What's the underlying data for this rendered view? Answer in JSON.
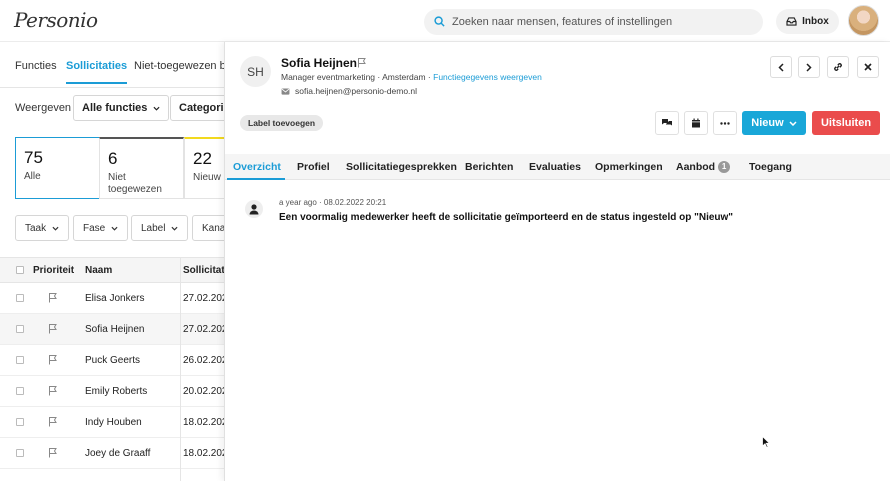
{
  "app": {
    "logo": "Personio"
  },
  "search": {
    "placeholder": "Zoeken naar mensen, features of instellingen"
  },
  "inbox": {
    "label": "Inbox"
  },
  "left": {
    "tabs": [
      "Functies",
      "Sollicitaties",
      "Niet-toegewezen ber"
    ],
    "filter_label": "Weergeven",
    "dropdowns": [
      "Alle functies",
      "Categorie"
    ],
    "stats": [
      {
        "num": "75",
        "label": "Alle"
      },
      {
        "num": "6",
        "label": "Niet toegewezen"
      },
      {
        "num": "22",
        "label": "Nieuw"
      }
    ],
    "filters": [
      "Taak",
      "Fase",
      "Label",
      "Kana"
    ],
    "columns": [
      "Prioriteit",
      "Naam",
      "Sollicitati"
    ],
    "rows": [
      {
        "name": "Elisa Jonkers",
        "date": "27.02.202"
      },
      {
        "name": "Sofia Heijnen",
        "date": "27.02.202"
      },
      {
        "name": "Puck Geerts",
        "date": "26.02.202"
      },
      {
        "name": "Emily Roberts",
        "date": "20.02.202"
      },
      {
        "name": "Indy Houben",
        "date": "18.02.202"
      },
      {
        "name": "Joey de Graaff",
        "date": "18.02.202"
      }
    ]
  },
  "panel": {
    "initials": "SH",
    "name": "Sofia Heijnen",
    "subtitle": "Manager eventmarketing · Amsterdam · ",
    "subtitle_link": "Functiegegevens weergeven",
    "email": "sofia.heijnen@personio-demo.nl",
    "label_button": "Label toevoegen",
    "new_button": "Nieuw",
    "exclude_button": "Uitsluiten",
    "tabs": [
      "Overzicht",
      "Profiel",
      "Sollicitatiegesprekken",
      "Berichten",
      "Evaluaties",
      "Opmerkingen",
      "Aanbod",
      "Toegang"
    ],
    "offer_badge": "1",
    "feed": {
      "time": "a year ago · 08.02.2022 20:21",
      "text": "Een voormalig medewerker heeft de sollicitatie geïmporteerd en de status ingesteld op \"Nieuw\""
    }
  },
  "colors": {
    "accent": "#1b9cd6",
    "primary_button": "#19a7d8",
    "danger_button": "#ea4c4c"
  }
}
